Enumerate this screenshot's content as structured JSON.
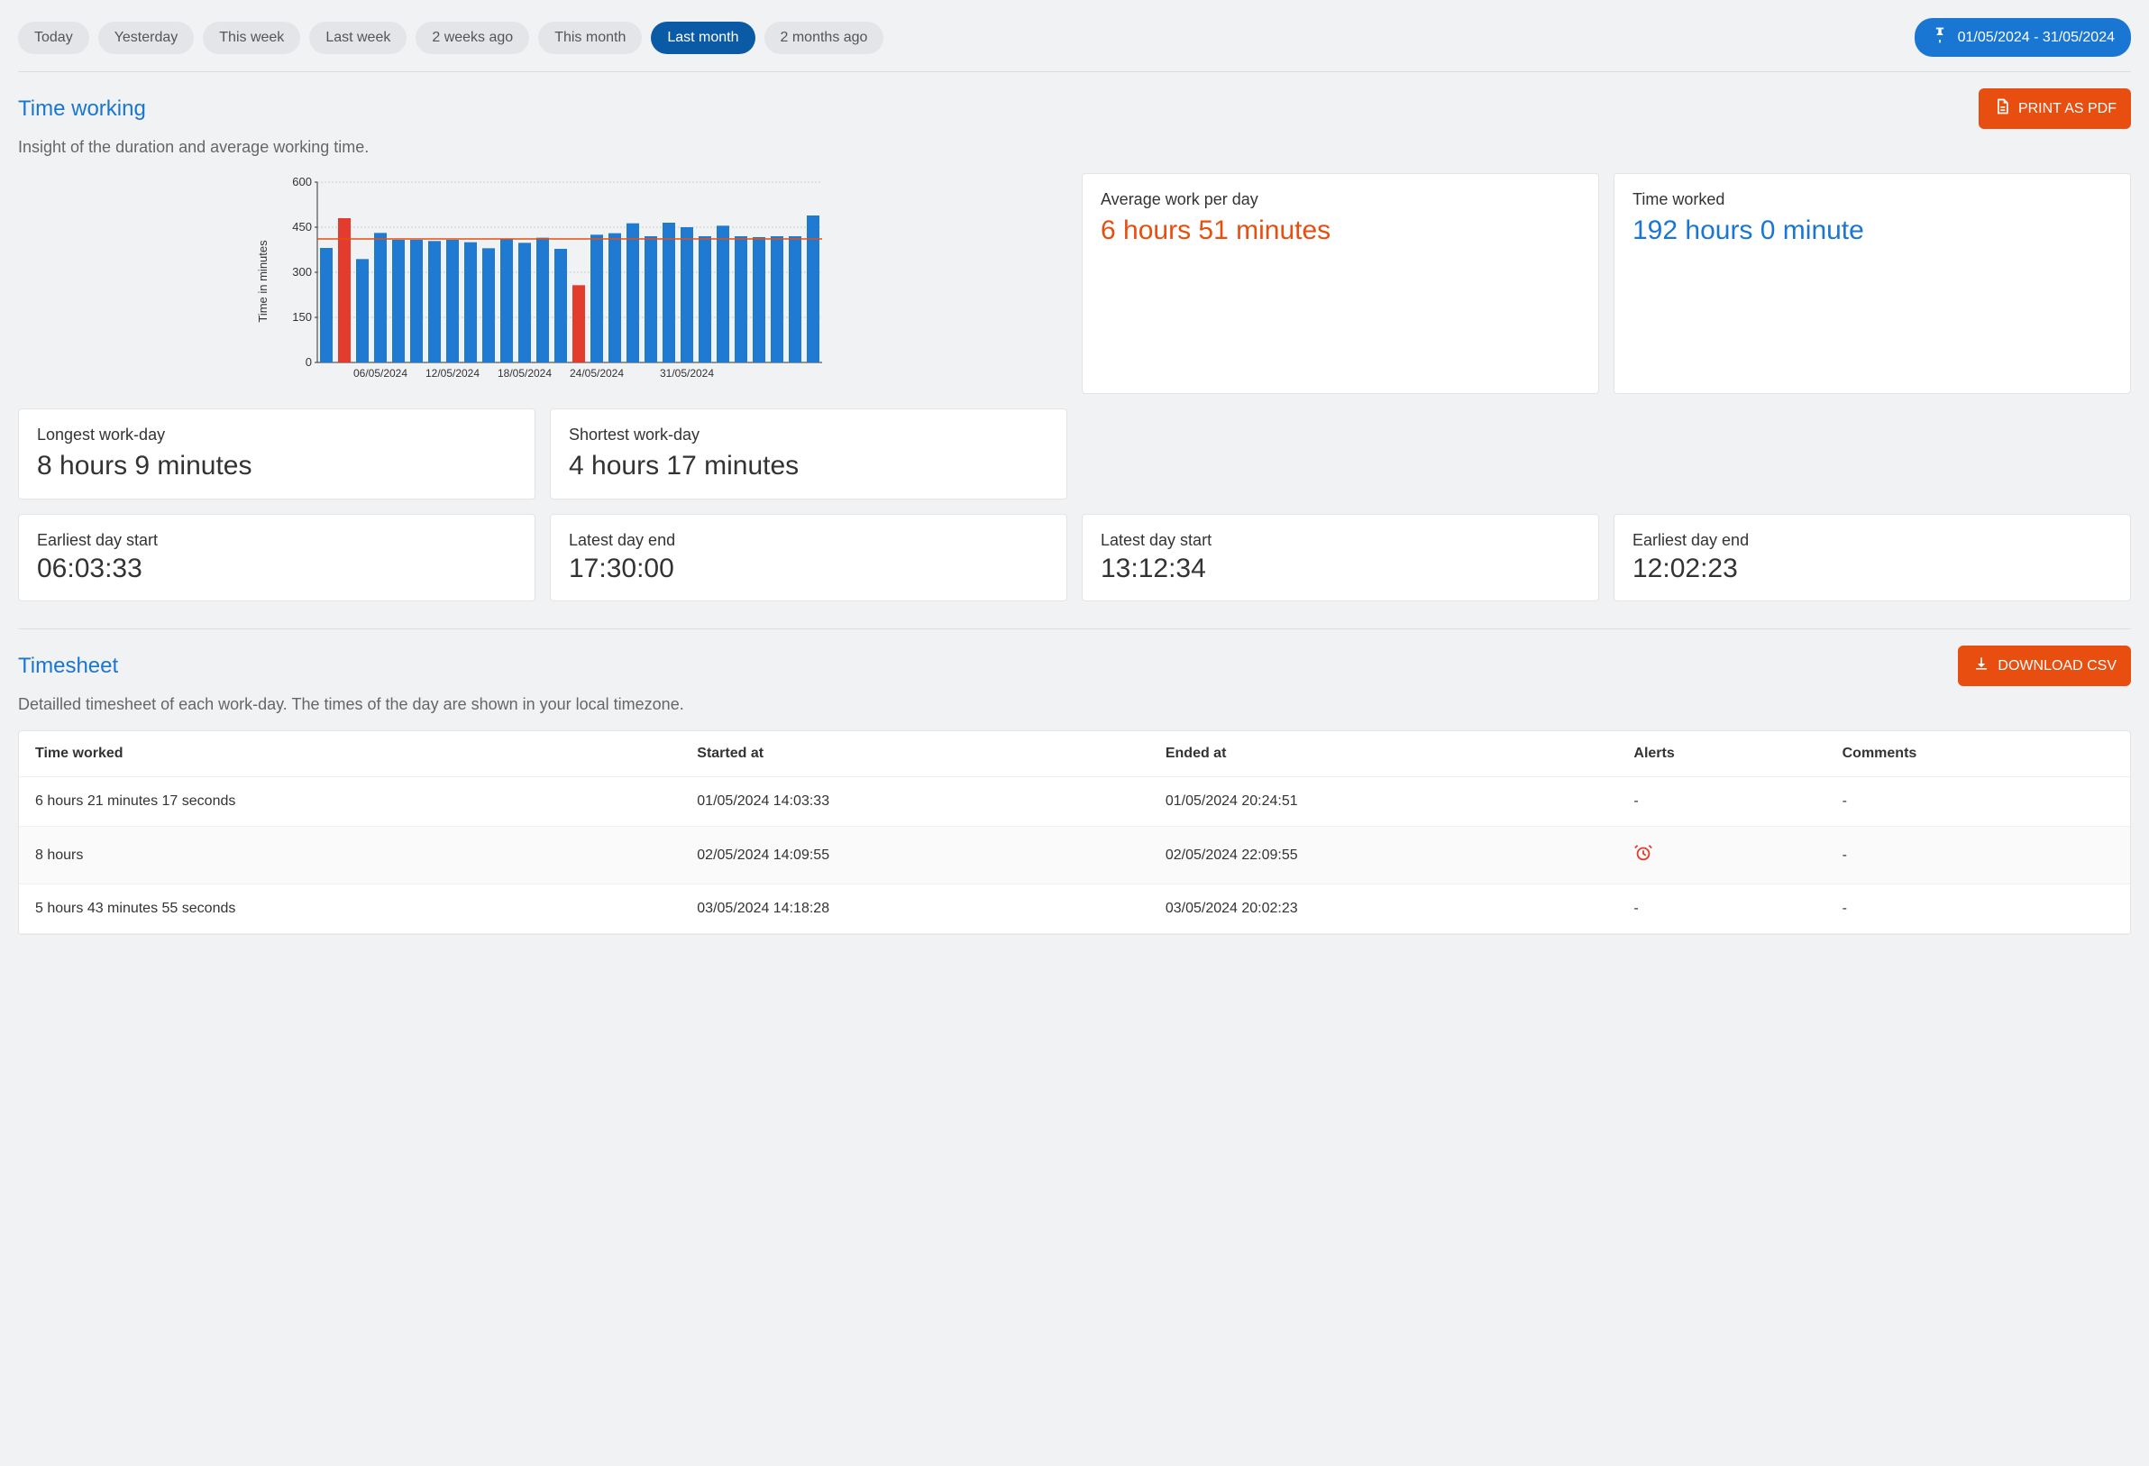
{
  "filters": {
    "chips": [
      "Today",
      "Yesterday",
      "This week",
      "Last week",
      "2 weeks ago",
      "This month",
      "Last month",
      "2 months ago"
    ],
    "active_index": 6
  },
  "date_range": "01/05/2024 - 31/05/2024",
  "time_working": {
    "title": "Time working",
    "subtitle": "Insight of the duration and average working time.",
    "print_label": "PRINT AS PDF"
  },
  "metrics": {
    "avg": {
      "label": "Average work per day",
      "value": "6 hours 51 minutes"
    },
    "total": {
      "label": "Time worked",
      "value": "192 hours 0 minute"
    },
    "longest": {
      "label": "Longest work-day",
      "value": "8 hours 9 minutes"
    },
    "shortest": {
      "label": "Shortest work-day",
      "value": "4 hours 17 minutes"
    },
    "earliest_start": {
      "label": "Earliest day start",
      "value": "06:03:33"
    },
    "latest_end": {
      "label": "Latest day end",
      "value": "17:30:00"
    },
    "latest_start": {
      "label": "Latest day start",
      "value": "13:12:34"
    },
    "earliest_end": {
      "label": "Earliest day end",
      "value": "12:02:23"
    }
  },
  "chart_data": {
    "type": "bar",
    "title": "",
    "xlabel": "",
    "ylabel": "Time in minutes",
    "ylim": [
      0,
      600
    ],
    "yticks": [
      0,
      150,
      300,
      450,
      600
    ],
    "xtick_labels": [
      "06/05/2024",
      "12/05/2024",
      "18/05/2024",
      "24/05/2024",
      "31/05/2024"
    ],
    "xtick_positions": [
      3,
      7,
      11,
      15,
      20
    ],
    "average_line": 411,
    "bars": [
      {
        "x": 0,
        "value": 381,
        "color": "blue"
      },
      {
        "x": 1,
        "value": 480,
        "color": "red"
      },
      {
        "x": 2,
        "value": 344,
        "color": "blue"
      },
      {
        "x": 3,
        "value": 431,
        "color": "blue"
      },
      {
        "x": 4,
        "value": 408,
        "color": "blue"
      },
      {
        "x": 5,
        "value": 408,
        "color": "blue"
      },
      {
        "x": 6,
        "value": 404,
        "color": "blue"
      },
      {
        "x": 7,
        "value": 408,
        "color": "blue"
      },
      {
        "x": 8,
        "value": 400,
        "color": "blue"
      },
      {
        "x": 9,
        "value": 380,
        "color": "blue"
      },
      {
        "x": 10,
        "value": 410,
        "color": "blue"
      },
      {
        "x": 11,
        "value": 398,
        "color": "blue"
      },
      {
        "x": 12,
        "value": 415,
        "color": "blue"
      },
      {
        "x": 13,
        "value": 378,
        "color": "blue"
      },
      {
        "x": 14,
        "value": 257,
        "color": "red"
      },
      {
        "x": 15,
        "value": 425,
        "color": "blue"
      },
      {
        "x": 16,
        "value": 430,
        "color": "blue"
      },
      {
        "x": 17,
        "value": 463,
        "color": "blue"
      },
      {
        "x": 18,
        "value": 420,
        "color": "blue"
      },
      {
        "x": 19,
        "value": 465,
        "color": "blue"
      },
      {
        "x": 20,
        "value": 450,
        "color": "blue"
      },
      {
        "x": 21,
        "value": 420,
        "color": "blue"
      },
      {
        "x": 22,
        "value": 455,
        "color": "blue"
      },
      {
        "x": 23,
        "value": 420,
        "color": "blue"
      },
      {
        "x": 24,
        "value": 417,
        "color": "blue"
      },
      {
        "x": 25,
        "value": 420,
        "color": "blue"
      },
      {
        "x": 26,
        "value": 420,
        "color": "blue"
      },
      {
        "x": 27,
        "value": 489,
        "color": "blue"
      }
    ]
  },
  "timesheet": {
    "title": "Timesheet",
    "subtitle": "Detailled timesheet of each work-day. The times of the day are shown in your local timezone.",
    "download_label": "DOWNLOAD CSV",
    "columns": [
      "Time worked",
      "Started at",
      "Ended at",
      "Alerts",
      "Comments"
    ],
    "rows": [
      {
        "time": "6 hours 21 minutes 17 seconds",
        "start": "01/05/2024 14:03:33",
        "end": "01/05/2024 20:24:51",
        "alerts": "-",
        "has_alert": false,
        "comments": "-"
      },
      {
        "time": "8 hours",
        "start": "02/05/2024 14:09:55",
        "end": "02/05/2024 22:09:55",
        "alerts": "",
        "has_alert": true,
        "comments": "-"
      },
      {
        "time": "5 hours 43 minutes 55 seconds",
        "start": "03/05/2024 14:18:28",
        "end": "03/05/2024 20:02:23",
        "alerts": "-",
        "has_alert": false,
        "comments": "-"
      }
    ]
  },
  "colors": {
    "blue": "#1f7ad1",
    "red": "#e33b2d",
    "orange": "#e84e0f"
  }
}
